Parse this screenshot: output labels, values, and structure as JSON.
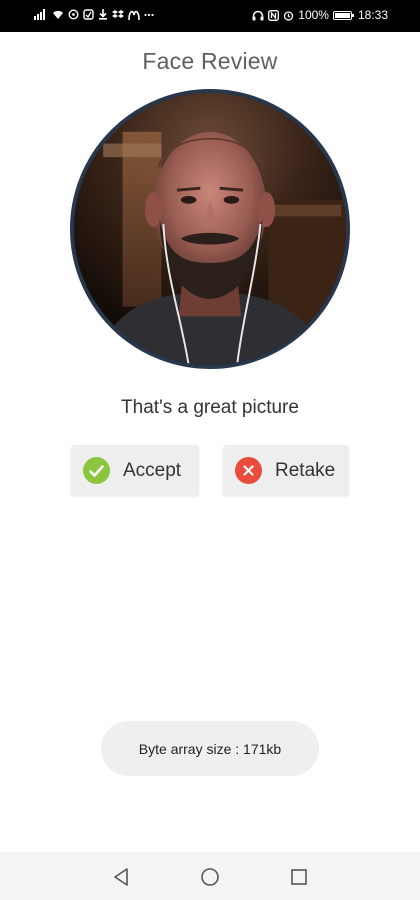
{
  "status_bar": {
    "battery": "100%",
    "time": "18:33",
    "icons_left": [
      "signal-icon",
      "wifi-icon",
      "whatsapp-icon",
      "app-icon",
      "download-icon",
      "dropbox-icon",
      "mcdonalds-icon",
      "more-icon"
    ],
    "icons_right": [
      "headphones-icon",
      "nfc-icon",
      "alarm-icon",
      "battery-icon"
    ],
    "battery_level": 1.0
  },
  "page": {
    "title": "Face Review",
    "message": "That's a great picture"
  },
  "actions": {
    "accept_label": "Accept",
    "retake_label": "Retake"
  },
  "toast": {
    "text": "Byte array size : 171kb"
  },
  "nav": {
    "items": [
      "back-icon",
      "home-icon",
      "recents-icon"
    ]
  },
  "colors": {
    "photo_border": "#28374c",
    "accept_icon": "#8cc63f",
    "retake_icon": "#e94b3c",
    "button_bg": "#eeeeee",
    "toast_bg": "#efefef"
  }
}
